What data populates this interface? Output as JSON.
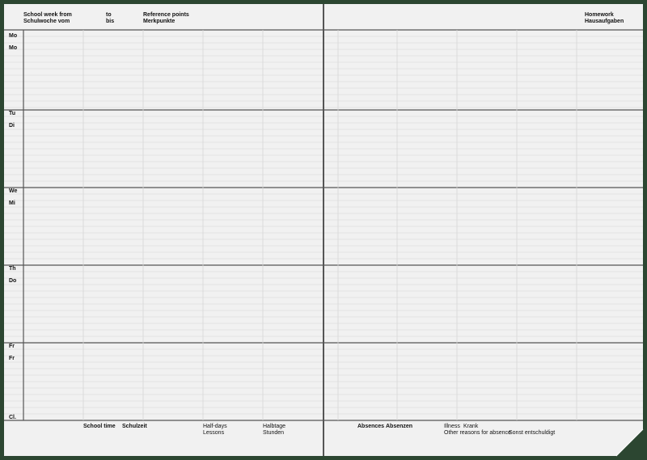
{
  "header": {
    "school_week_from_en": "School week from",
    "school_week_from_de": "Schulwoche vom",
    "to_en": "to",
    "to_de": "bis",
    "reference_points_en": "Reference points",
    "reference_points_de": "Merkpunkte",
    "homework_en": "Homework",
    "homework_de": "Hausaufgaben"
  },
  "days": [
    {
      "en": "Mo",
      "de": "Mo"
    },
    {
      "en": "Tu",
      "de": "Di"
    },
    {
      "en": "We",
      "de": "Mi"
    },
    {
      "en": "Th",
      "de": "Do"
    },
    {
      "en": "Fr",
      "de": "Fr"
    }
  ],
  "class_label": "Cl.",
  "footer": {
    "school_time_en": "School time",
    "school_time_de": "Schulzeit",
    "half_days_en": "Half-days",
    "lessons_en": "Lessons",
    "half_days_de": "Halbtage",
    "lessons_de": "Stunden",
    "absences_en": "Absences",
    "absences_de": "Absenzen",
    "illness_en": "Illness",
    "illness_de": "Krank",
    "other_reasons_en": "Other reasons for absence",
    "other_reasons_de": "Sonst entschuldigt"
  },
  "colors": {
    "cover": "#2c4631",
    "paper": "#f1f1f1",
    "rule_line": "#d6d6d6",
    "frame_line": "#555555"
  }
}
